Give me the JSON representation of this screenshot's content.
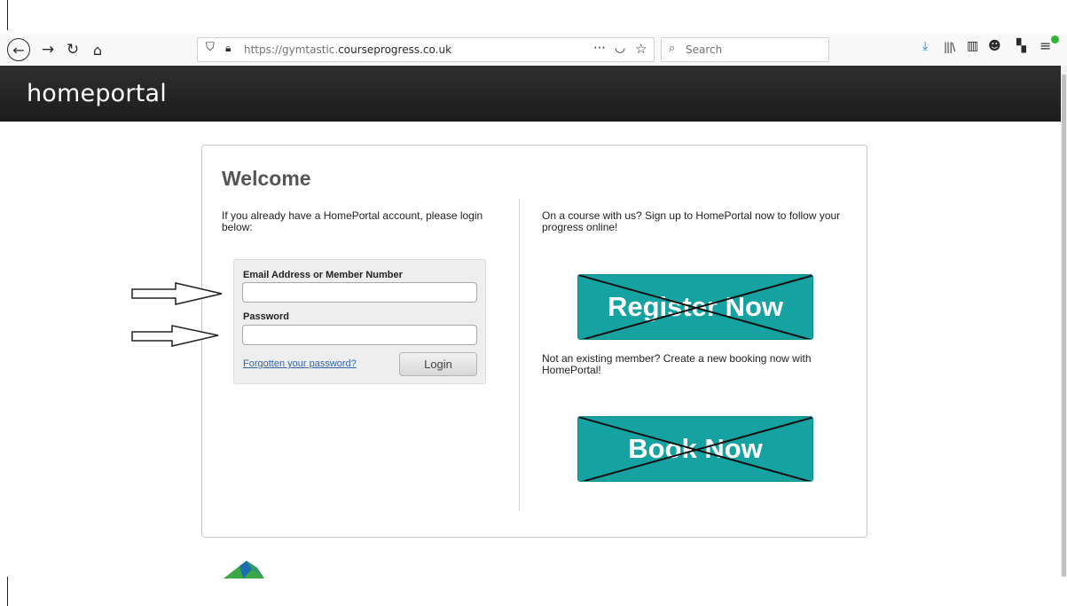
{
  "browser": {
    "url_prefix": "https://gymtastic.",
    "url_domain": "courseprogress.co.uk",
    "search_placeholder": "Search",
    "icons": [
      "back-icon",
      "forward-icon",
      "reload-icon",
      "home-icon",
      "shield-icon",
      "lock-icon",
      "more-icon",
      "pocket-icon",
      "bookmark-star-icon",
      "search-icon",
      "download-icon",
      "library-icon",
      "sidebar-icon",
      "account-icon",
      "extension-icon",
      "menu-icon"
    ]
  },
  "header": {
    "logo_text": "homeportal"
  },
  "panel": {
    "title": "Welcome",
    "login_intro": "If you already have a HomePortal account, please login below:",
    "email_label": "Email Address or Member Number",
    "email_value": "",
    "password_label": "Password",
    "password_value": "",
    "forgot_link": "Forgotten your password?",
    "login_button": "Login",
    "signup_intro": "On a course with us? Sign up to HomePortal now to follow your progress online!",
    "register_button": "Register Now",
    "booking_intro": "Not an existing member? Create a new booking now with HomePortal!",
    "book_button": "Book Now"
  },
  "colors": {
    "header_bg": "#222222",
    "cta_teal": "#15a2a0",
    "link_blue": "#3366aa"
  }
}
